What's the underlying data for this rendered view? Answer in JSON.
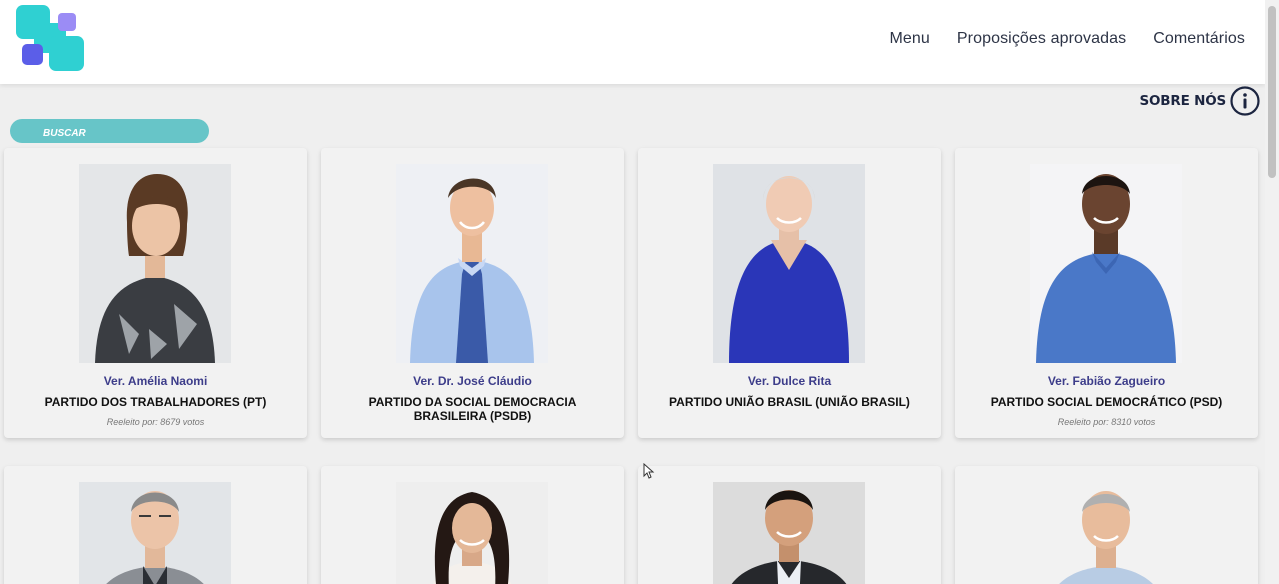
{
  "nav": {
    "items": [
      "Menu",
      "Proposições aprovadas",
      "Comentários"
    ]
  },
  "sobre": {
    "label": "SOBRE NÓS"
  },
  "search": {
    "label": "BUSCAR"
  },
  "cards": [
    {
      "name": "Ver. Amélia Naomi",
      "party": "PARTIDO DOS TRABALHADORES (PT)",
      "votes": "Reeleito por: 8679 votos"
    },
    {
      "name": "Ver. Dr. José Cláudio",
      "party": "PARTIDO DA SOCIAL DEMOCRACIA BRASILEIRA (PSDB)",
      "votes": ""
    },
    {
      "name": "Ver. Dulce Rita",
      "party": "PARTIDO UNIÃO BRASIL (UNIÃO BRASIL)",
      "votes": ""
    },
    {
      "name": "Ver. Fabião Zagueiro",
      "party": "PARTIDO SOCIAL DEMOCRÁTICO (PSD)",
      "votes": "Reeleito por: 8310 votos"
    }
  ],
  "colors": {
    "accent": "#67c5c8",
    "logo_teal": "#2fd0d2",
    "logo_purple": "#9b8cf5",
    "logo_blue": "#5b5ee8",
    "name_color": "#3d3d8a"
  }
}
